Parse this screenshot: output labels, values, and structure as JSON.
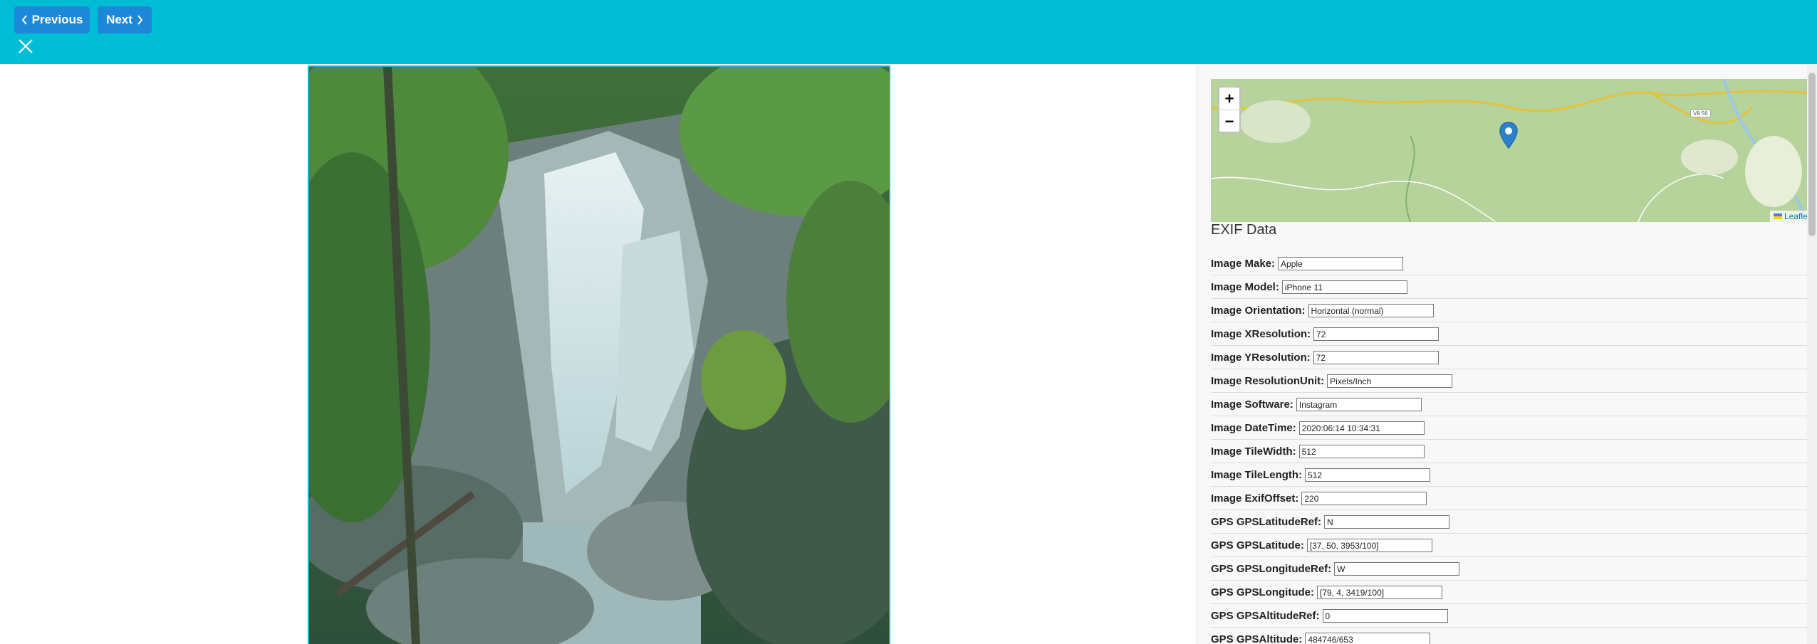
{
  "nav": {
    "previous_label": "Previous",
    "next_label": "Next",
    "accent_color": "#00bcd4",
    "button_color": "#1e88d8"
  },
  "map": {
    "zoom_in": "+",
    "zoom_out": "−",
    "attribution": "Leaflet",
    "road_label": "VA 56"
  },
  "exif": {
    "title": "EXIF Data",
    "rows": [
      {
        "label": "Image Make:",
        "value": "Apple"
      },
      {
        "label": "Image Model:",
        "value": "iPhone 11"
      },
      {
        "label": "Image Orientation:",
        "value": "Horizontal (normal)"
      },
      {
        "label": "Image XResolution:",
        "value": "72"
      },
      {
        "label": "Image YResolution:",
        "value": "72"
      },
      {
        "label": "Image ResolutionUnit:",
        "value": "Pixels/Inch"
      },
      {
        "label": "Image Software:",
        "value": "Instagram"
      },
      {
        "label": "Image DateTime:",
        "value": "2020:06:14 10:34:31"
      },
      {
        "label": "Image TileWidth:",
        "value": "512"
      },
      {
        "label": "Image TileLength:",
        "value": "512"
      },
      {
        "label": "Image ExifOffset:",
        "value": "220"
      },
      {
        "label": "GPS GPSLatitudeRef:",
        "value": "N"
      },
      {
        "label": "GPS GPSLatitude:",
        "value": "[37, 50, 3953/100]"
      },
      {
        "label": "GPS GPSLongitudeRef:",
        "value": "W"
      },
      {
        "label": "GPS GPSLongitude:",
        "value": "[79, 4, 3419/100]"
      },
      {
        "label": "GPS GPSAltitudeRef:",
        "value": "0"
      },
      {
        "label": "GPS GPSAltitude:",
        "value": "484746/653"
      }
    ]
  }
}
